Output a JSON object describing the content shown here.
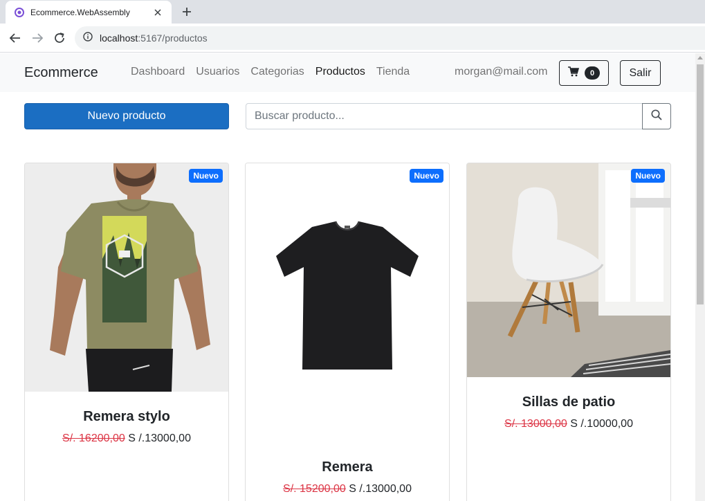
{
  "browser": {
    "tab_title": "Ecommerce.WebAssembly",
    "url_host": "localhost",
    "url_path": ":5167/productos"
  },
  "navbar": {
    "brand": "Ecommerce",
    "links": [
      {
        "label": "Dashboard",
        "active": false
      },
      {
        "label": "Usuarios",
        "active": false
      },
      {
        "label": "Categorias",
        "active": false
      },
      {
        "label": "Productos",
        "active": true
      },
      {
        "label": "Tienda",
        "active": false
      }
    ],
    "user_email": "morgan@mail.com",
    "cart_count": "0",
    "logout_label": "Salir"
  },
  "actions": {
    "new_product_label": "Nuevo producto",
    "search_placeholder": "Buscar producto..."
  },
  "products": [
    {
      "badge": "Nuevo",
      "name": "Remera stylo",
      "old_price": "S/. 16200,00",
      "price": "S /.13000,00",
      "image": "man-olive-tshirt"
    },
    {
      "badge": "Nuevo",
      "name": "Remera",
      "old_price": "S/. 15200,00",
      "price": "S /.13000,00",
      "image": "black-tshirt"
    },
    {
      "badge": "Nuevo",
      "name": "Sillas de patio",
      "old_price": "S/. 13000,00",
      "price": "S /.10000,00",
      "image": "white-chair"
    }
  ],
  "colors": {
    "primary": "#1b6ec2",
    "badge": "#0d6efd",
    "old_price": "#dc3545"
  }
}
